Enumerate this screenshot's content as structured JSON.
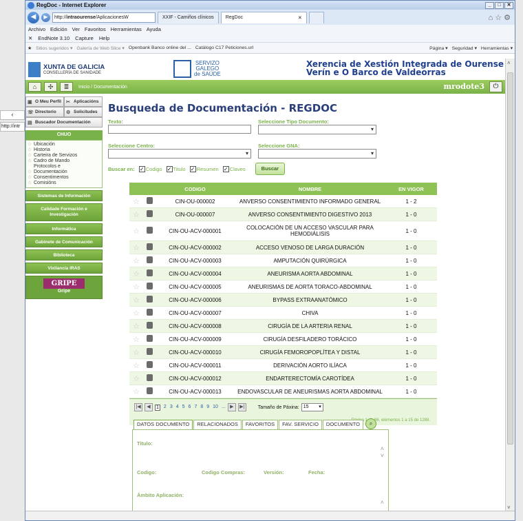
{
  "background": {
    "url_fragment": "http://intr"
  },
  "browser": {
    "title": "RegDoc - Internet Explorer",
    "address_prefix": "http://",
    "address_host": "intraourense",
    "address_path": "/AplicacionesW",
    "tabs": [
      {
        "label": "XXIF - Camiños clínicos"
      },
      {
        "label": "RegDoc"
      }
    ],
    "menu": [
      "Archivo",
      "Edición",
      "Ver",
      "Favoritos",
      "Herramientas",
      "Ayuda"
    ],
    "commands": [
      "EndNote 3.10",
      "Capture",
      "Help"
    ],
    "favorites": [
      "Sitios sugeridos ▾",
      "Galería de Web Slice ▾",
      "Openbank Banco online del ...",
      "Catálogo C17 Peticiones.url"
    ],
    "favorites_right": [
      "Página ▾",
      "Seguridad ▾",
      "Herramientas ▾"
    ]
  },
  "header": {
    "xunta_title": "XUNTA DE GALICIA",
    "xunta_sub": "CONSELLERÍA DE SANIDADE",
    "sergas": [
      "SERVIZO",
      "GALEGO",
      "de SAÚDE"
    ],
    "xerencia_1": "Xerencia de Xestión Integrada de Ourense",
    "xerencia_2": "Verín e O Barco de Valdeorras"
  },
  "nav": {
    "breadcrumb": "Inicio / Documentación",
    "user": "mrodote3"
  },
  "sidebar": {
    "top_buttons": [
      "O Meu Perfil",
      "Aplicacións",
      "Directorio",
      "Solicitudes"
    ],
    "buscador": "Buscador Documentación",
    "chuo_title": "CHUO",
    "chuo_items": [
      "Ubicación",
      "Historia",
      "Carteira de Servizos",
      "Cadro de Mando",
      "Protocolos e",
      "Documentación",
      "Consentimentos",
      "Comisións"
    ],
    "menus": [
      "Sistemas de Información",
      "Calidade Formación e Investigación",
      "Informática",
      "Gabinete de Comunicación",
      "Biblioteca",
      "Vixilancia IRAS"
    ],
    "gripe_label": "GRIPE",
    "gripe_sub": "Gripe"
  },
  "form": {
    "title": "Busqueda de Documentación - REGDOC",
    "texto_label": "Texto:",
    "tipo_label": "Seleccione Tipo Documento:",
    "centro_label": "Seleccione Centro:",
    "gna_label": "Seleccione GNA:",
    "buscar_en": "Buscar en:",
    "checks": [
      "Codigo",
      "Titulo",
      "Resumen",
      "Claves"
    ],
    "buscar_btn": "Buscar"
  },
  "grid": {
    "headers": [
      "CODIGO",
      "NOMBRE",
      "EN VIGOR"
    ],
    "rows": [
      {
        "code": "CIN-OU-000002",
        "name": "ANVERSO CONSENTIMIENTO INFORMADO GENERAL",
        "vigor": "1 - 2"
      },
      {
        "code": "CIN-OU-000007",
        "name": "ANVERSO CONSENTIMIENTO DIGESTIVO 2013",
        "vigor": "1 - 0"
      },
      {
        "code": "CIN-OU-ACV-000001",
        "name": "COLOCACIÓN DE UN ACCESO VASCULAR PARA HEMODIÁLISIS",
        "vigor": "1 - 0"
      },
      {
        "code": "CIN-OU-ACV-000002",
        "name": "ACCESO VENOSO DE LARGA DURACIÓN",
        "vigor": "1 - 0"
      },
      {
        "code": "CIN-OU-ACV-000003",
        "name": "AMPUTACIÓN QUIRÚRGICA",
        "vigor": "1 - 0"
      },
      {
        "code": "CIN-OU-ACV-000004",
        "name": "ANEURISMA AORTA ABDOMINAL",
        "vigor": "1 - 0"
      },
      {
        "code": "CIN-OU-ACV-000005",
        "name": "ANEURISMAS DE AORTA TORACO-ABDOMINAL",
        "vigor": "1 - 0"
      },
      {
        "code": "CIN-OU-ACV-000006",
        "name": "BYPASS EXTRAANATÓMICO",
        "vigor": "1 - 0"
      },
      {
        "code": "CIN-OU-ACV-000007",
        "name": "CHIVA",
        "vigor": "1 - 0"
      },
      {
        "code": "CIN-OU-ACV-000008",
        "name": "CIRUGÍA DE LA ARTERIA RENAL",
        "vigor": "1 - 0"
      },
      {
        "code": "CIN-OU-ACV-000009",
        "name": "CIRUGÍA DESFILADERO TORÁCICO",
        "vigor": "1 - 0"
      },
      {
        "code": "CIN-OU-ACV-000010",
        "name": "CIRUGÍA FEMOROPOPLÍTEA Y DISTAL",
        "vigor": "1 - 0"
      },
      {
        "code": "CIN-OU-ACV-000011",
        "name": "DERIVACIÓN AORTO ILÍACA",
        "vigor": "1 - 0"
      },
      {
        "code": "CIN-OU-ACV-000012",
        "name": "ENDARTERECTOMÍA CAROTÍDEA",
        "vigor": "1 - 0"
      },
      {
        "code": "CIN-OU-ACV-000013",
        "name": "ENDOVASCULAR DE ANEURISMAS AORTA ABDOMINAL",
        "vigor": "1 - 0"
      }
    ],
    "pages": [
      "1",
      "2",
      "3",
      "4",
      "5",
      "6",
      "7",
      "8",
      "9",
      "10",
      "..."
    ],
    "page_size_label": "Tamaño de Páxina:",
    "page_size": "15",
    "page_info": "Páxina 1 de 86, elementos 1 a 15 de 1288."
  },
  "detail": {
    "tabs": [
      "DATOS DOCUMENTO",
      "RELACIONADOS",
      "FAVORITOS",
      "FAV. SERVICIO",
      "DOCUMENTO"
    ],
    "titulo": "Titulo:",
    "codigo": "Codigo:",
    "codigo_compras": "Codigo Compras:",
    "version": "Versión:",
    "fecha": "Fecha:",
    "ambito": "Ámbito Aplicación:"
  }
}
